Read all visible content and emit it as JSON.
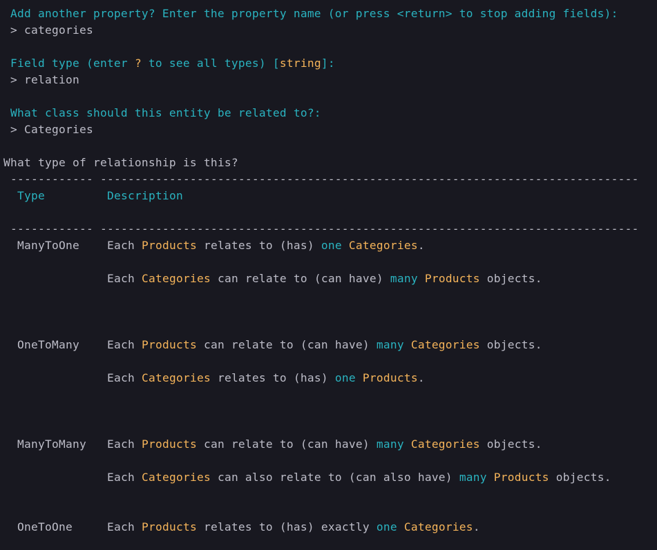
{
  "prompts": {
    "add_property": "Add another property? Enter the property name (or press <return> to stop adding fields):",
    "add_property_answer": "> categories",
    "field_type_prefix": "Field type (enter ",
    "field_type_q": "?",
    "field_type_mid": " to see all types) [",
    "field_type_default": "string",
    "field_type_suffix": "]:",
    "field_type_answer": "> relation",
    "related_class": "What class should this entity be related to?:",
    "related_class_answer": "> Categories",
    "relationship_question": "What type of relationship is this?"
  },
  "table": {
    "rule_type": "------------",
    "rule_desc": "------------------------------------------------------------------------------",
    "header_type": "Type",
    "header_description": "Description",
    "rows": [
      {
        "type": "ManyToOne",
        "lines": [
          [
            "Each ",
            "Products",
            " relates to (has) ",
            "one",
            " ",
            "Categories",
            "."
          ],
          [
            "Each ",
            "Categories",
            " can relate to (can have) ",
            "many",
            " ",
            "Products",
            " objects."
          ]
        ]
      },
      {
        "type": "OneToMany",
        "lines": [
          [
            "Each ",
            "Products",
            " can relate to (can have) ",
            "many",
            " ",
            "Categories",
            " objects."
          ],
          [
            "Each ",
            "Categories",
            " relates to (has) ",
            "one",
            " ",
            "Products",
            "."
          ]
        ]
      },
      {
        "type": "ManyToMany",
        "lines": [
          [
            "Each ",
            "Products",
            " can relate to (can have) ",
            "many",
            " ",
            "Categories",
            " objects."
          ],
          [
            "Each ",
            "Categories",
            " can also relate to (can also have) ",
            "many",
            " ",
            "Products",
            " objects."
          ]
        ]
      },
      {
        "type": "OneToOne",
        "lines": [
          [
            "Each ",
            "Products",
            " relates to (has) exactly ",
            "one",
            " ",
            "Categories",
            "."
          ]
        ]
      }
    ]
  },
  "colors": {
    "background": "#181820",
    "cyan": "#2ab3c0",
    "orange": "#f5b45a",
    "text": "#bdbdc8"
  }
}
